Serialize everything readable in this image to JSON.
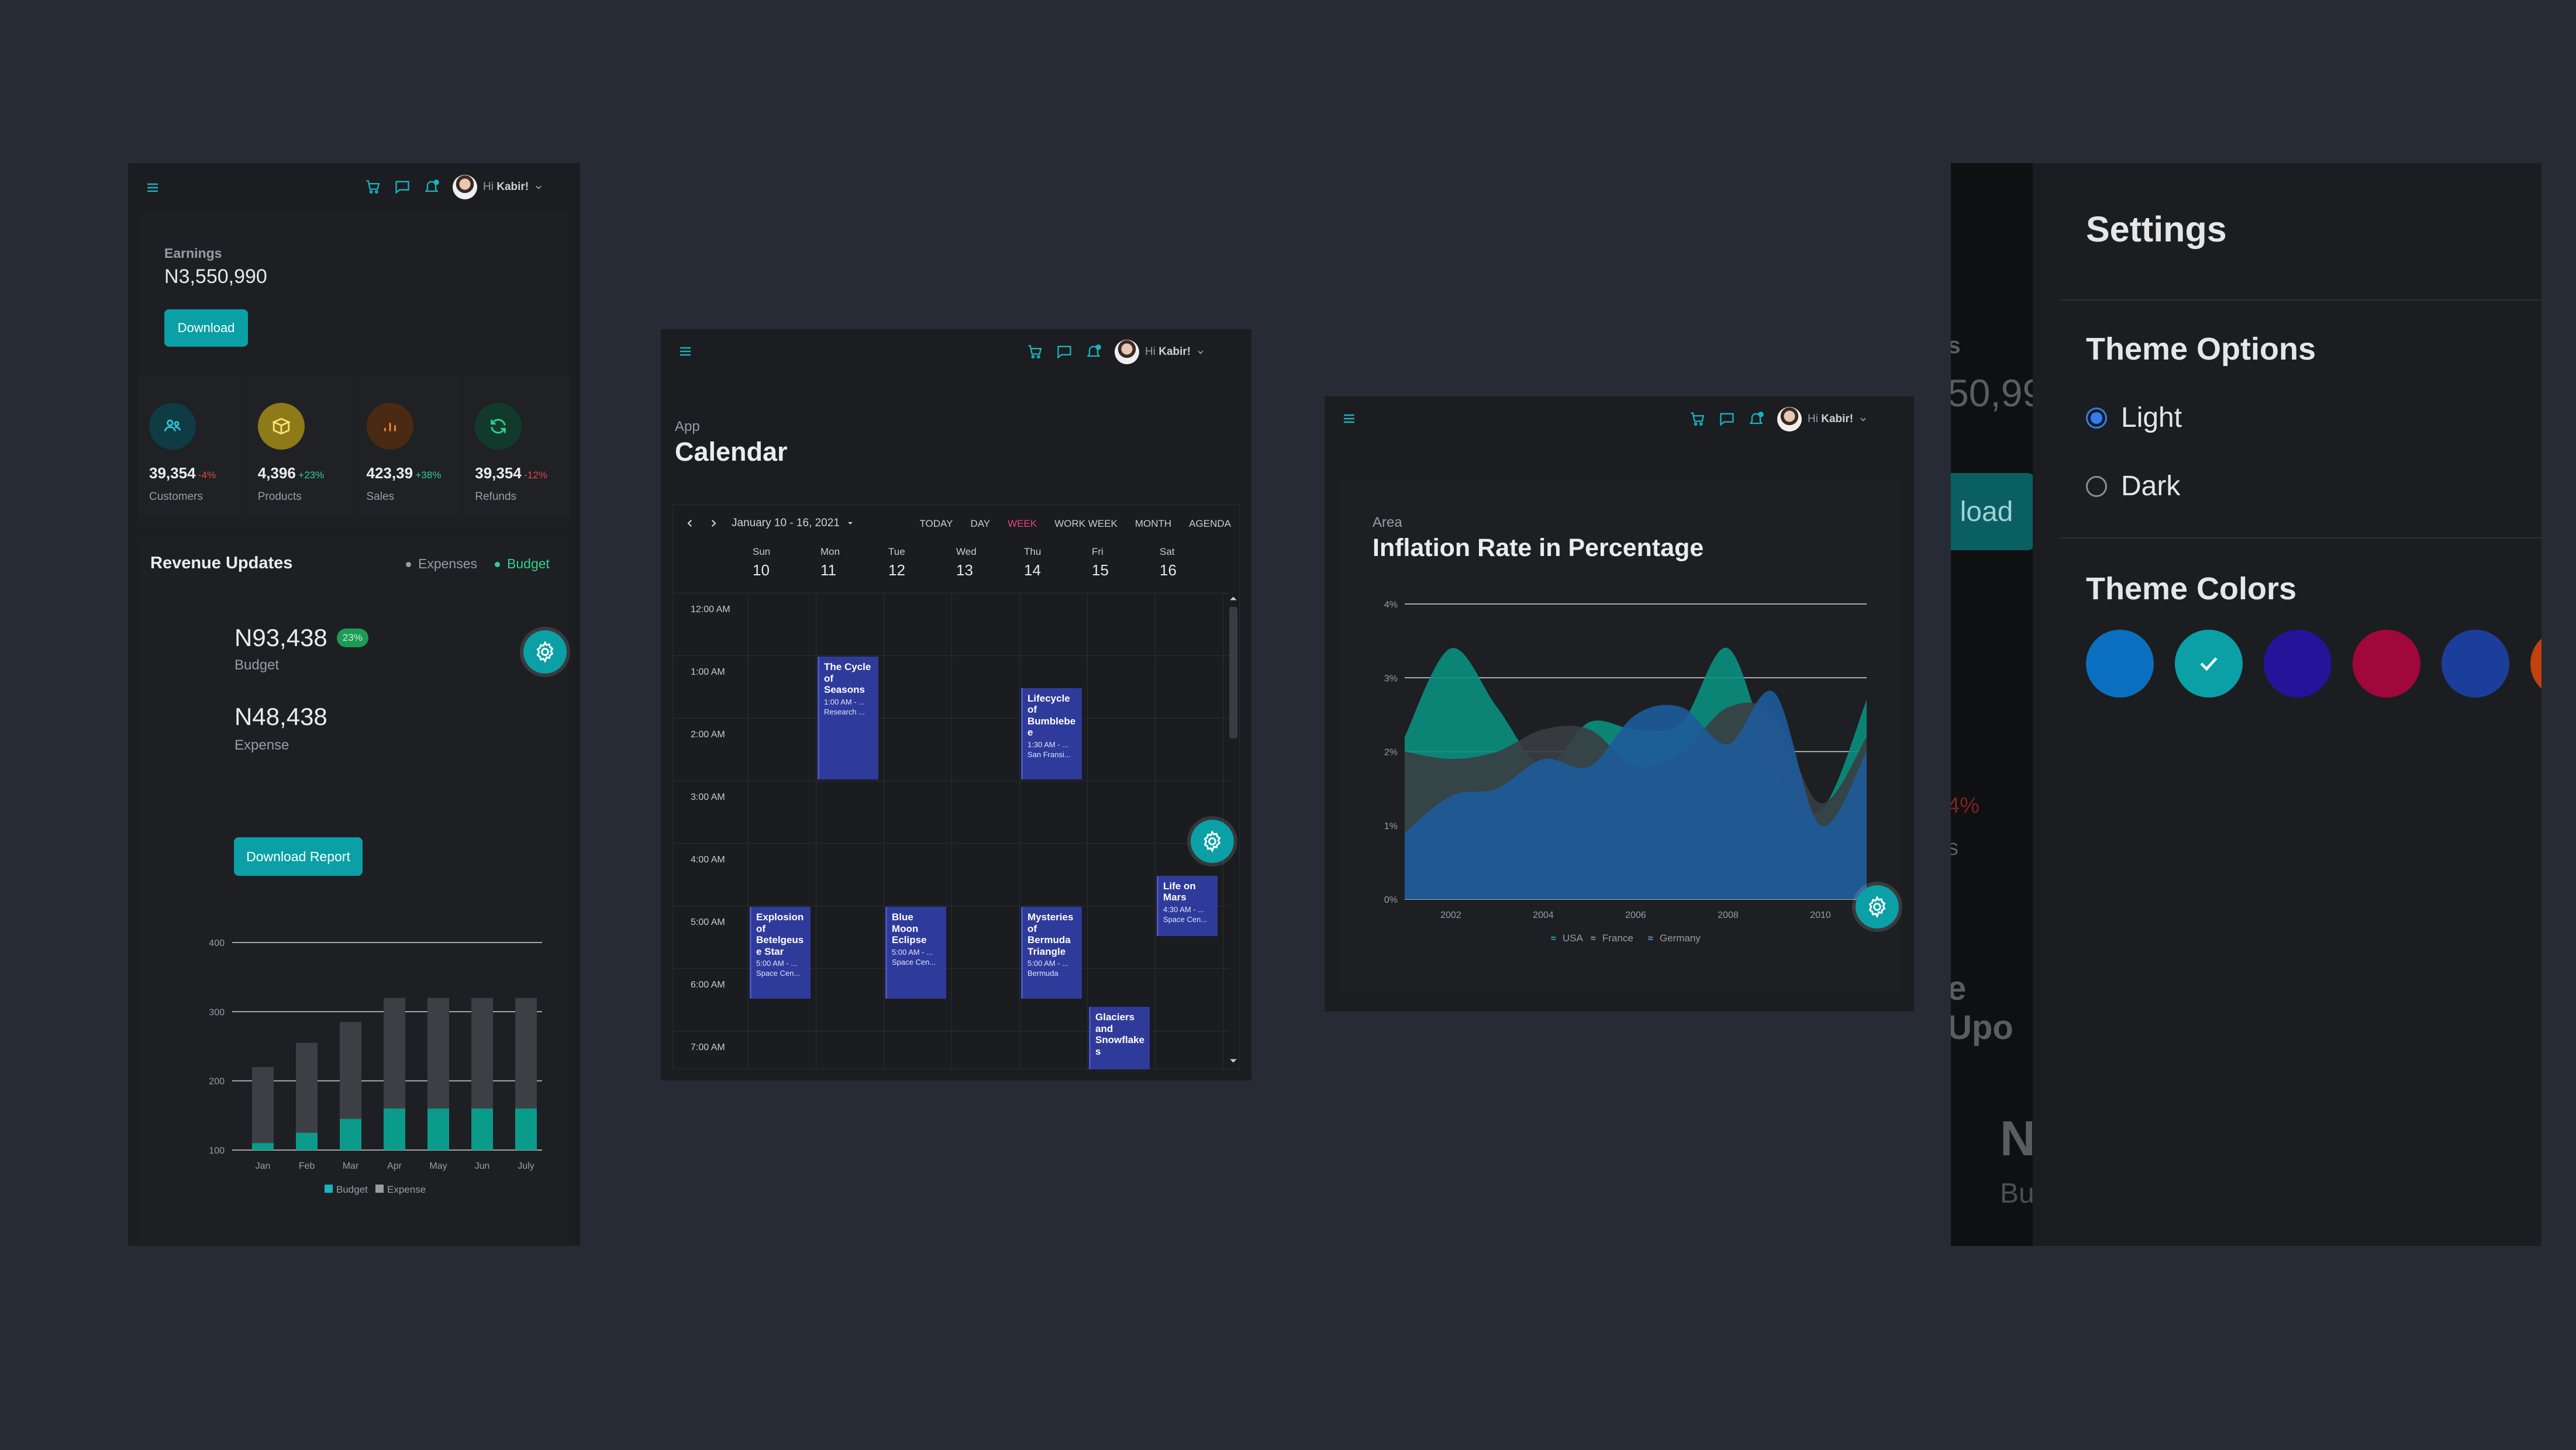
{
  "dashboard": {
    "user_greeting": "Hi",
    "user_name": "Kabir!",
    "earnings_label": "Earnings",
    "earnings_value": "N3,550,990",
    "download_label": "Download",
    "stats": [
      {
        "value": "39,354",
        "change": "-4%",
        "label": "Customers",
        "icon": "users-icon",
        "bg": "#0e3b44",
        "fg": "#31c2d2",
        "trend": "down"
      },
      {
        "value": "4,396",
        "change": "+23%",
        "label": "Products",
        "icon": "box-icon",
        "bg": "#8e7a16",
        "fg": "#ffe17a",
        "trend": "up"
      },
      {
        "value": "423,39",
        "change": "+38%",
        "label": "Sales",
        "icon": "bar-chart-icon",
        "bg": "#4a2a12",
        "fg": "#f08a3c",
        "trend": "up"
      },
      {
        "value": "39,354",
        "change": "-12%",
        "label": "Refunds",
        "icon": "refresh-icon",
        "bg": "#123a2c",
        "fg": "#2fd28f",
        "trend": "down"
      }
    ],
    "revenue_title": "Revenue Updates",
    "legend_expenses": "Expenses",
    "legend_budget": "Budget",
    "budget_value": "N93,438",
    "budget_badge": "23%",
    "budget_label": "Budget",
    "expense_value": "N48,438",
    "expense_label": "Expense",
    "download_report_label": "Download Report",
    "chart_legend_budget": "Budget",
    "chart_legend_expense": "Expense"
  },
  "calendar": {
    "user_greeting": "Hi",
    "user_name": "Kabir!",
    "breadcrumb": "App",
    "title": "Calendar",
    "date_range": "January 10 - 16, 2021",
    "views": [
      "TODAY",
      "DAY",
      "WEEK",
      "WORK WEEK",
      "MONTH",
      "AGENDA"
    ],
    "active_view": "WEEK",
    "days": [
      {
        "name": "Sun",
        "num": "10"
      },
      {
        "name": "Mon",
        "num": "11"
      },
      {
        "name": "Tue",
        "num": "12"
      },
      {
        "name": "Wed",
        "num": "13"
      },
      {
        "name": "Thu",
        "num": "14"
      },
      {
        "name": "Fri",
        "num": "15"
      },
      {
        "name": "Sat",
        "num": "16"
      }
    ],
    "times": [
      "12:00 AM",
      "1:00 AM",
      "2:00 AM",
      "3:00 AM",
      "4:00 AM",
      "5:00 AM",
      "6:00 AM",
      "7:00 AM"
    ],
    "events": [
      {
        "title": "The Cycle of Seasons",
        "time": "1:00 AM - ...",
        "place": "Research ..."
      },
      {
        "title": "Lifecycle of Bumblebe e",
        "time": "1:30 AM - ...",
        "place": "San Fransi..."
      },
      {
        "title": "Explosion of Betelgeus e Star",
        "time": "5:00 AM - ...",
        "place": "Space Cen..."
      },
      {
        "title": "Blue Moon Eclipse",
        "time": "5:00 AM - ...",
        "place": "Space Cen..."
      },
      {
        "title": "Mysteries of Bermuda Triangle",
        "time": "5:00 AM - ...",
        "place": "Bermuda"
      },
      {
        "title": "Life on Mars",
        "time": "4:30 AM - ...",
        "place": "Space Cen..."
      },
      {
        "title": "Glaciers and Snowflake s",
        "time": "",
        "place": ""
      }
    ]
  },
  "area_chart": {
    "user_greeting": "Hi",
    "user_name": "Kabir!",
    "breadcrumb": "Area",
    "title": "Inflation Rate in Percentage"
  },
  "settings": {
    "title": "Settings",
    "theme_options_title": "Theme Options",
    "light_label": "Light",
    "dark_label": "Dark",
    "selected_mode": "Light",
    "theme_colors_title": "Theme Colors",
    "colors": [
      "#0b6fbf",
      "#0aa0a5",
      "#26139a",
      "#a0073a",
      "#1a3e9a",
      "#c2410c"
    ],
    "selected_color": "#0aa0a5",
    "bg_fragments": [
      "gs",
      "50,99",
      "load",
      "4%",
      "s",
      "e Upo",
      "N",
      "Bu"
    ]
  },
  "chart_data": [
    {
      "type": "bar",
      "title": "",
      "categories": [
        "Jan",
        "Feb",
        "Mar",
        "Apr",
        "May",
        "Jun",
        "July"
      ],
      "series": [
        {
          "name": "Budget",
          "values": [
            110,
            125,
            145,
            160,
            160,
            160,
            160
          ]
        },
        {
          "name": "Expense",
          "values": [
            220,
            255,
            285,
            320,
            320,
            320,
            320
          ]
        }
      ],
      "ylim": [
        100,
        400
      ],
      "yticks": [
        100,
        200,
        300,
        400
      ],
      "grid": true,
      "legend": "bottom",
      "colors": {
        "Budget": "#0a9b8b",
        "Expense": "#3d3f44"
      }
    },
    {
      "type": "area",
      "title": "Inflation Rate in Percentage",
      "x": [
        2001,
        2002,
        2003,
        2004,
        2005,
        2006,
        2007,
        2008,
        2009,
        2010,
        2011
      ],
      "xticks": [
        2002,
        2004,
        2006,
        2008,
        2010
      ],
      "yticks": [
        "0%",
        "1%",
        "2%",
        "3%",
        "4%"
      ],
      "ylim": [
        0,
        4
      ],
      "grid": true,
      "legend": "bottom",
      "series": [
        {
          "name": "USA",
          "values": [
            2.2,
            3.4,
            2.6,
            1.8,
            2.4,
            2.3,
            2.4,
            3.4,
            1.8,
            1.2,
            2.7
          ],
          "color": "#0a8f80"
        },
        {
          "name": "France",
          "values": [
            2.0,
            1.9,
            2.0,
            2.3,
            2.3,
            1.8,
            2.0,
            2.6,
            2.5,
            1.3,
            2.2
          ],
          "color": "#3a3d42"
        },
        {
          "name": "Germany",
          "values": [
            0.9,
            1.4,
            1.5,
            1.9,
            1.8,
            2.5,
            2.6,
            2.1,
            2.8,
            1.0,
            2.0
          ],
          "color": "#1e5b9a"
        }
      ]
    }
  ]
}
